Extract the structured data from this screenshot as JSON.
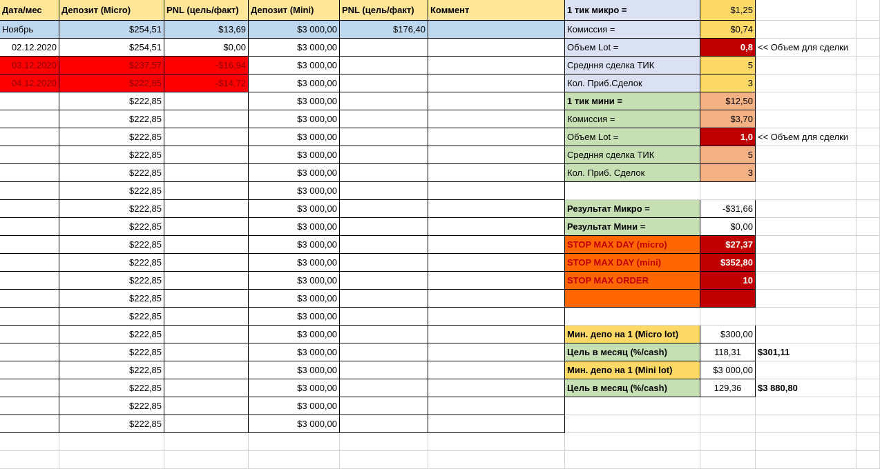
{
  "colors": {
    "header": "#ffe699",
    "month_row": "#bdd7ee",
    "loss_red": "#ff0000",
    "loss_text": "#8b0000",
    "micro_panel": "#d9e1f2",
    "mini_panel": "#c6e0b4",
    "yellow": "#ffd966",
    "salmon": "#f4b183",
    "dark_red": "#c00000",
    "orange": "#ff6600",
    "green": "#c6e0b4"
  },
  "headers": [
    "Дата/мес",
    "Депозит (Micro)",
    "PNL (цель/факт)",
    "Депозит (Mini)",
    "PNL (цель/факт)",
    "Коммент"
  ],
  "month_row": {
    "date": "Ноябрь",
    "dep_micro": "$254,51",
    "pnl_micro": "$13,69",
    "dep_mini": "$3 000,00",
    "pnl_mini": "$176,40",
    "comment": ""
  },
  "rows": [
    {
      "date": "02.12.2020",
      "dep_micro": "$254,51",
      "pnl_micro": "$0,00",
      "dep_mini": "$3 000,00",
      "loss": false
    },
    {
      "date": "03.12.2020",
      "dep_micro": "$237,57",
      "pnl_micro": "-$16,94",
      "dep_mini": "$3 000,00",
      "loss": true
    },
    {
      "date": "04.12.2020",
      "dep_micro": "$222,85",
      "pnl_micro": "-$14,72",
      "dep_mini": "$3 000,00",
      "loss": true
    },
    {
      "date": "",
      "dep_micro": "$222,85",
      "pnl_micro": "",
      "dep_mini": "$3 000,00",
      "loss": false
    },
    {
      "date": "",
      "dep_micro": "$222,85",
      "pnl_micro": "",
      "dep_mini": "$3 000,00",
      "loss": false
    },
    {
      "date": "",
      "dep_micro": "$222,85",
      "pnl_micro": "",
      "dep_mini": "$3 000,00",
      "loss": false
    },
    {
      "date": "",
      "dep_micro": "$222,85",
      "pnl_micro": "",
      "dep_mini": "$3 000,00",
      "loss": false
    },
    {
      "date": "",
      "dep_micro": "$222,85",
      "pnl_micro": "",
      "dep_mini": "$3 000,00",
      "loss": false
    },
    {
      "date": "",
      "dep_micro": "$222,85",
      "pnl_micro": "",
      "dep_mini": "$3 000,00",
      "loss": false
    },
    {
      "date": "",
      "dep_micro": "$222,85",
      "pnl_micro": "",
      "dep_mini": "$3 000,00",
      "loss": false
    },
    {
      "date": "",
      "dep_micro": "$222,85",
      "pnl_micro": "",
      "dep_mini": "$3 000,00",
      "loss": false
    },
    {
      "date": "",
      "dep_micro": "$222,85",
      "pnl_micro": "",
      "dep_mini": "$3 000,00",
      "loss": false
    },
    {
      "date": "",
      "dep_micro": "$222,85",
      "pnl_micro": "",
      "dep_mini": "$3 000,00",
      "loss": false
    },
    {
      "date": "",
      "dep_micro": "$222,85",
      "pnl_micro": "",
      "dep_mini": "$3 000,00",
      "loss": false
    },
    {
      "date": "",
      "dep_micro": "$222,85",
      "pnl_micro": "",
      "dep_mini": "$3 000,00",
      "loss": false
    },
    {
      "date": "",
      "dep_micro": "$222,85",
      "pnl_micro": "",
      "dep_mini": "$3 000,00",
      "loss": false
    },
    {
      "date": "",
      "dep_micro": "$222,85",
      "pnl_micro": "",
      "dep_mini": "$3 000,00",
      "loss": false
    },
    {
      "date": "",
      "dep_micro": "$222,85",
      "pnl_micro": "",
      "dep_mini": "$3 000,00",
      "loss": false
    },
    {
      "date": "",
      "dep_micro": "$222,85",
      "pnl_micro": "",
      "dep_mini": "$3 000,00",
      "loss": false
    },
    {
      "date": "",
      "dep_micro": "$222,85",
      "pnl_micro": "",
      "dep_mini": "$3 000,00",
      "loss": false
    },
    {
      "date": "",
      "dep_micro": "$222,85",
      "pnl_micro": "",
      "dep_mini": "$3 000,00",
      "loss": false
    },
    {
      "date": "",
      "dep_micro": "$222,85",
      "pnl_micro": "",
      "dep_mini": "$3 000,00",
      "loss": false
    }
  ],
  "params_micro": [
    {
      "label": "1 тик микро =",
      "value": "$1,25",
      "bold": true,
      "value_style": "yellow"
    },
    {
      "label": "Комиссия =",
      "value": "$0,74",
      "bold": false,
      "value_style": "yellow"
    },
    {
      "label": "Объем  Lot =",
      "value": "0,8",
      "bold": false,
      "value_style": "dark_red",
      "note": "<< Объем для сделки"
    },
    {
      "label": "Средння сделка ТИК",
      "value": "5",
      "bold": false,
      "value_style": "yellow"
    },
    {
      "label": "Кол. Приб.Сделок",
      "value": "3",
      "bold": false,
      "value_style": "yellow"
    }
  ],
  "params_mini": [
    {
      "label": "1 тик мини =",
      "value": "$12,50",
      "bold": true,
      "value_style": "salmon"
    },
    {
      "label": "Комиссия =",
      "value": "$3,70",
      "bold": false,
      "value_style": "salmon"
    },
    {
      "label": "Объем  Lot =",
      "value": "1,0",
      "bold": false,
      "value_style": "dark_red",
      "note": "<< Объем для сделки"
    },
    {
      "label": "Средння сделка ТИК",
      "value": "5",
      "bold": false,
      "value_style": "salmon"
    },
    {
      "label": "Кол. Приб. Сделок",
      "value": "3",
      "bold": false,
      "value_style": "salmon"
    }
  ],
  "results": [
    {
      "label": "Результат Микро =",
      "value": "-$31,66"
    },
    {
      "label": "Результат Мини =",
      "value": "$0,00"
    }
  ],
  "stops": [
    {
      "label": "STOP MAX DAY (micro)",
      "value": "$27,37"
    },
    {
      "label": "STOP MAX DAY (mini)",
      "value": "$352,80"
    },
    {
      "label": "STOP MAX ORDER",
      "value": "10"
    },
    {
      "label": "",
      "value": ""
    }
  ],
  "targets": [
    {
      "label": "Мин. депо на 1 (Micro lot)",
      "value": "$300,00",
      "extra": "",
      "label_style": "yellow"
    },
    {
      "label": "Цель в месяц (%/cash)",
      "value": "118,31",
      "extra": "$301,11",
      "label_style": "green"
    },
    {
      "label": "Мин. депо на 1 (Mini lot)",
      "value": "$3 000,00",
      "extra": "",
      "label_style": "yellow"
    },
    {
      "label": "Цель в месяц (%/cash)",
      "value": "129,36",
      "extra": "$3 880,80",
      "label_style": "green"
    }
  ]
}
